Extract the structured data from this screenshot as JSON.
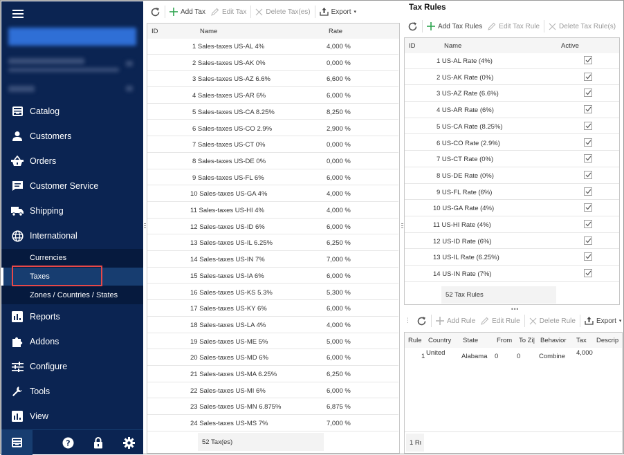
{
  "sidebar": {
    "menu_icon": "hamburger-icon",
    "nav": [
      {
        "label": "Catalog",
        "icon": "catalog-icon"
      },
      {
        "label": "Customers",
        "icon": "customer-icon"
      },
      {
        "label": "Orders",
        "icon": "basket-icon"
      },
      {
        "label": "Customer Service",
        "icon": "chat-icon"
      },
      {
        "label": "Shipping",
        "icon": "truck-icon"
      },
      {
        "label": "International",
        "icon": "globe-icon"
      },
      {
        "label": "Reports",
        "icon": "chart-icon"
      },
      {
        "label": "Addons",
        "icon": "puzzle-icon"
      },
      {
        "label": "Configure",
        "icon": "sliders-icon"
      },
      {
        "label": "Tools",
        "icon": "wrench-icon"
      },
      {
        "label": "View",
        "icon": "chart-icon"
      }
    ],
    "sub_items": [
      {
        "label": "Currencies"
      },
      {
        "label": "Taxes",
        "active": true
      },
      {
        "label": "Zones / Countries / States"
      }
    ],
    "bottom_icons": [
      "catalog-icon",
      "help-icon",
      "lock-icon",
      "gear-icon"
    ]
  },
  "taxes": {
    "toolbar": {
      "refresh": "refresh-icon",
      "add": "Add Tax",
      "edit": "Edit Tax",
      "delete": "Delete Tax(es)",
      "export": "Export"
    },
    "columns": [
      "ID",
      "Name",
      "Rate"
    ],
    "rows": [
      {
        "name": "1 Sales-taxes US-AL 4%",
        "rate": "4,000 %"
      },
      {
        "name": "2 Sales-taxes US-AK 0%",
        "rate": "0,000 %"
      },
      {
        "name": "3 Sales-taxes US-AZ 6.6%",
        "rate": "6,600 %"
      },
      {
        "name": "4 Sales-taxes US-AR 6%",
        "rate": "6,000 %"
      },
      {
        "name": "5 Sales-taxes US-CA 8.25%",
        "rate": "8,250 %"
      },
      {
        "name": "6 Sales-taxes US-CO 2.9%",
        "rate": "2,900 %"
      },
      {
        "name": "7 Sales-taxes US-CT 0%",
        "rate": "0,000 %"
      },
      {
        "name": "8 Sales-taxes US-DE 0%",
        "rate": "0,000 %"
      },
      {
        "name": "9 Sales-taxes US-FL 6%",
        "rate": "6,000 %"
      },
      {
        "name": "10 Sales-taxes US-GA 4%",
        "rate": "4,000 %"
      },
      {
        "name": "11 Sales-taxes US-HI 4%",
        "rate": "4,000 %"
      },
      {
        "name": "12 Sales-taxes US-ID 6%",
        "rate": "6,000 %"
      },
      {
        "name": "13 Sales-taxes US-IL 6.25%",
        "rate": "6,250 %"
      },
      {
        "name": "14 Sales-taxes US-IN 7%",
        "rate": "7,000 %"
      },
      {
        "name": "15 Sales-taxes US-IA 6%",
        "rate": "6,000 %"
      },
      {
        "name": "16 Sales-taxes US-KS 5.3%",
        "rate": "5,300 %"
      },
      {
        "name": "17 Sales-taxes US-KY 6%",
        "rate": "6,000 %"
      },
      {
        "name": "18 Sales-taxes US-LA 4%",
        "rate": "4,000 %"
      },
      {
        "name": "19 Sales-taxes US-ME 5%",
        "rate": "5,000 %"
      },
      {
        "name": "20 Sales-taxes US-MD 6%",
        "rate": "6,000 %"
      },
      {
        "name": "21 Sales-taxes US-MA 6.25%",
        "rate": "6,250 %"
      },
      {
        "name": "22 Sales-taxes US-MI 6%",
        "rate": "6,000 %"
      },
      {
        "name": "23 Sales-taxes US-MN 6.875%",
        "rate": "6,875 %"
      },
      {
        "name": "24 Sales-taxes US-MS 7%",
        "rate": "7,000 %"
      }
    ],
    "footer": "52 Tax(es)"
  },
  "tax_rules": {
    "title": "Tax Rules",
    "toolbar": {
      "refresh": "refresh-icon",
      "add": "Add Tax Rules",
      "edit": "Edit Tax Rule",
      "delete": "Delete Tax Rule(s)"
    },
    "columns": [
      "ID",
      "Name",
      "Active"
    ],
    "rows": [
      {
        "name": "1 US-AL Rate (4%)",
        "active": true
      },
      {
        "name": "2 US-AK Rate (0%)",
        "active": true
      },
      {
        "name": "3 US-AZ Rate (6.6%)",
        "active": true
      },
      {
        "name": "4 US-AR Rate (6%)",
        "active": true
      },
      {
        "name": "5 US-CA Rate (8.25%)",
        "active": true
      },
      {
        "name": "6 US-CO Rate (2.9%)",
        "active": true
      },
      {
        "name": "7 US-CT Rate (0%)",
        "active": true
      },
      {
        "name": "8 US-DE Rate (0%)",
        "active": true
      },
      {
        "name": "9 US-FL Rate (6%)",
        "active": true
      },
      {
        "name": "10 US-GA Rate (4%)",
        "active": true
      },
      {
        "name": "11 US-HI Rate (4%)",
        "active": true
      },
      {
        "name": "12 US-ID Rate (6%)",
        "active": true
      },
      {
        "name": "13 US-IL Rate (6.25%)",
        "active": true
      },
      {
        "name": "14 US-IN Rate (7%)",
        "active": true
      }
    ],
    "footer": "52 Tax Rules"
  },
  "rules": {
    "toolbar": {
      "refresh": "refresh-icon",
      "add": "Add Rule",
      "edit": "Edit Rule",
      "delete": "Delete Rule",
      "export": "Export"
    },
    "columns": [
      "Rule",
      "Country",
      "State",
      "From",
      "To Zi|",
      "Behavior",
      "Tax",
      "Descrip"
    ],
    "rows": [
      {
        "rule": "1",
        "country": "United",
        "state": "Alabama",
        "from": "0",
        "to": "0",
        "behavior": "Combine",
        "tax": "4,000",
        "description": ""
      }
    ],
    "footer": "1 Rι"
  },
  "colors": {
    "sidebar_bg": "#0b2452",
    "sidebar_sub_bg": "#061a3e",
    "sidebar_active": "#173d70",
    "highlight": "#e84848",
    "add_green": "#2ea44f"
  }
}
